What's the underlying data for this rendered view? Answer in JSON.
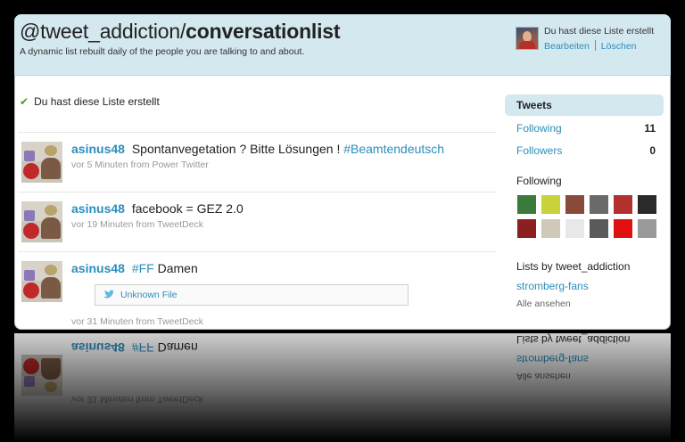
{
  "header": {
    "title_prefix": "@tweet_addiction/",
    "title_slug": "conversationlist",
    "description": "A dynamic list rebuilt daily of the people you are talking to and about.",
    "owner_note": "Du hast diese Liste erstellt",
    "edit_label": "Bearbeiten",
    "delete_label": "Löschen"
  },
  "main": {
    "created_notice": "Du hast diese Liste erstellt",
    "tweets": [
      {
        "user": "asinus48",
        "text": "Spontanvegetation ? Bitte Lösungen !",
        "hashtag": "#Beamtendeutsch",
        "time": "vor 5 Minuten",
        "source_prefix": "from",
        "source": "Power Twitter"
      },
      {
        "user": "asinus48",
        "text": "facebook = GEZ 2.0",
        "hashtag": "",
        "time": "vor 19 Minuten",
        "source_prefix": "from",
        "source": "TweetDeck"
      },
      {
        "user": "asinus48",
        "text": "Damen",
        "hashtag": "#FF",
        "time": "vor 31 Minuten",
        "source_prefix": "from",
        "source": "TweetDeck",
        "media_label": "Unknown File"
      }
    ]
  },
  "sidebar": {
    "tab_label": "Tweets",
    "following_label": "Following",
    "following_count": "11",
    "followers_label": "Followers",
    "followers_count": "0",
    "following_heading": "Following",
    "following_thumb_colors": [
      "#3a7a3a",
      "#c8d23a",
      "#8a4a3a",
      "#6a6a6a",
      "#b33030",
      "#2a2a2a",
      "#8c1f1f",
      "#d0c8b8",
      "#e8e8e8",
      "#5a5a5a",
      "#e01010",
      "#9a9a9a"
    ],
    "lists_heading": "Lists by tweet_addiction",
    "list_link": "stromberg-fans",
    "view_all": "Alle ansehen"
  },
  "colors": {
    "accent": "#2b8ebc",
    "header_bg": "#d4e8f0",
    "page_bg": "#000000"
  }
}
